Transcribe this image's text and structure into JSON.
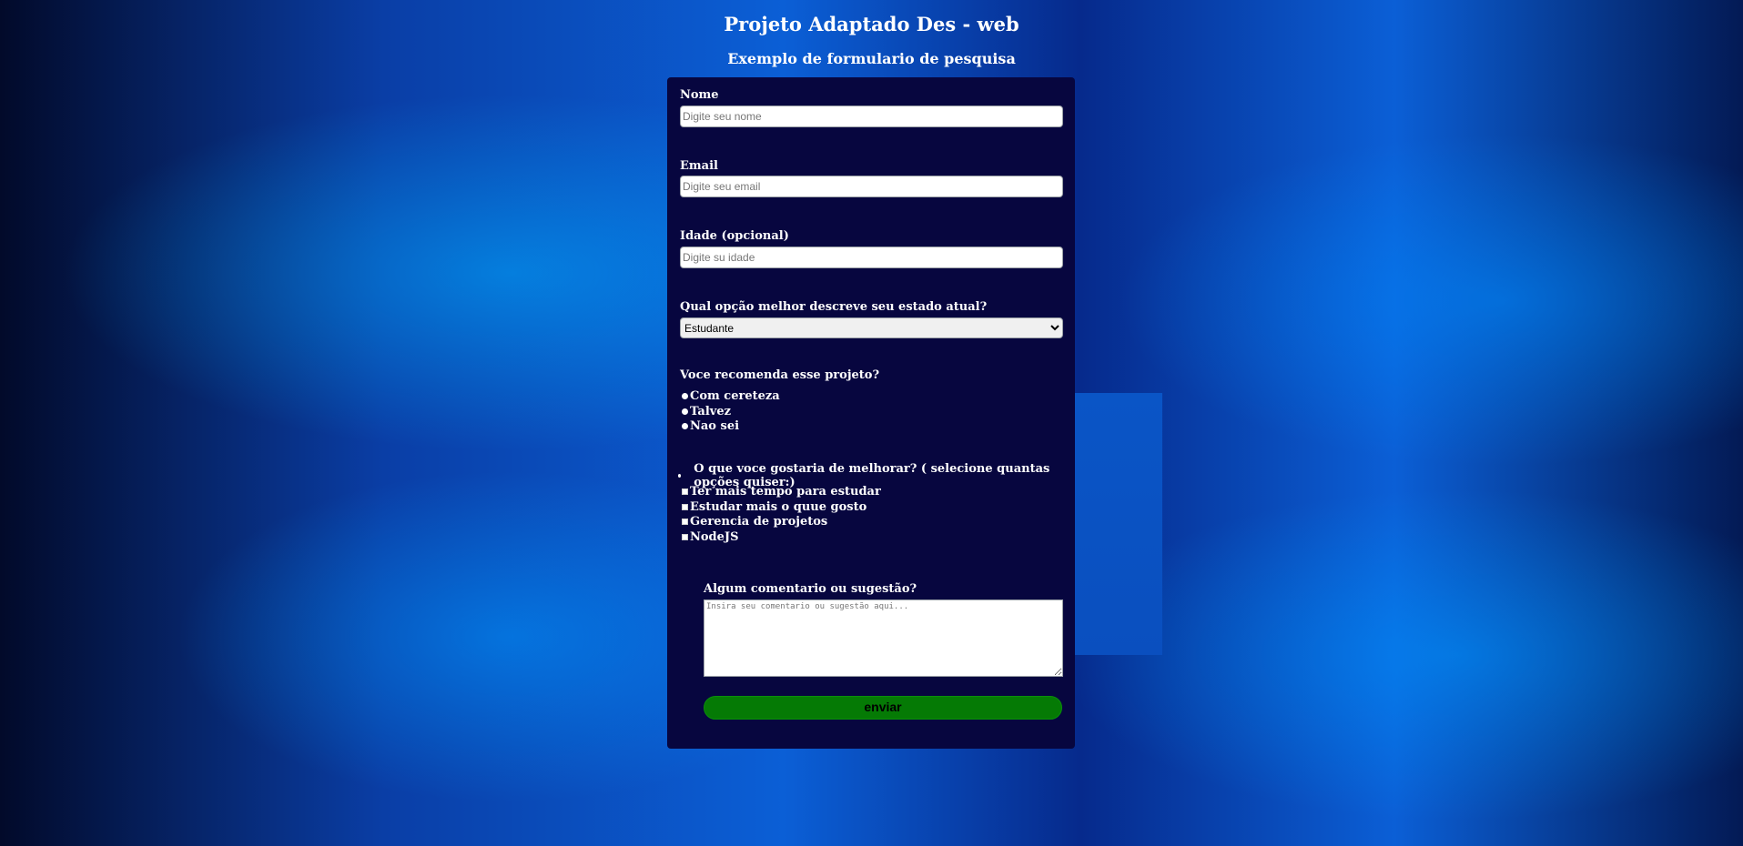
{
  "page": {
    "title": "Projeto Adaptado Des - web",
    "subtitle": "Exemplo de formulario de pesquisa"
  },
  "form": {
    "nome": {
      "label": "Nome",
      "placeholder": "Digite seu nome",
      "value": ""
    },
    "email": {
      "label": "Email",
      "placeholder": "Digite seu email",
      "value": ""
    },
    "idade": {
      "label": "Idade (opcional)",
      "placeholder": "Digite su idade",
      "value": ""
    },
    "estado": {
      "label": "Qual opção melhor descreve seu estado atual?",
      "selected": "Estudante"
    },
    "recomenda": {
      "label": "Voce recomenda esse projeto?",
      "options": [
        "Com cereteza",
        "Talvez",
        "Nao sei"
      ]
    },
    "melhorar": {
      "label": "O que voce gostaria de melhorar? ( selecione quantas opções quiser:)",
      "options": [
        "Ter mais tempo para estudar",
        "Estudar mais o quue gosto",
        "Gerencia de projetos",
        "NodeJS"
      ]
    },
    "comentario": {
      "label": "Algum comentario ou sugestão?",
      "placeholder": "Insira seu comentario ou sugestão aqui..."
    },
    "submit_label": "enviar"
  },
  "colors": {
    "card_bg": "#07063f",
    "submit_bg": "#057a05"
  }
}
